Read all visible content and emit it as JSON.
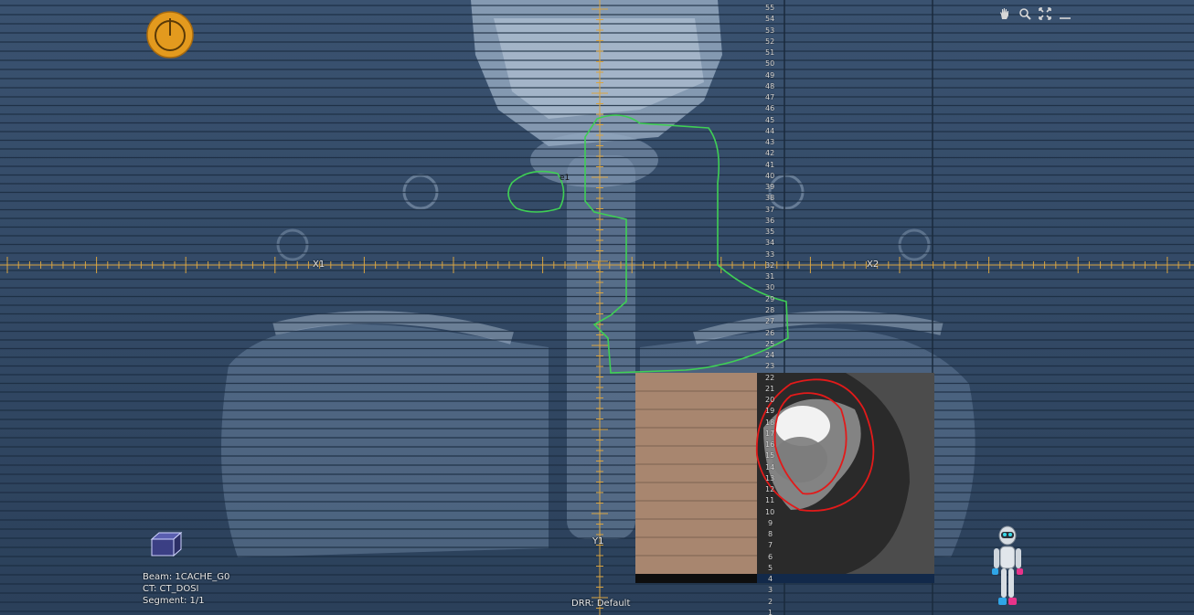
{
  "view": {
    "x_jaw_left_label": "X1",
    "x_jaw_right_label": "X2",
    "y_jaw_label": "Y1",
    "structure_label": "e1"
  },
  "info": {
    "beam": "Beam: 1CACHE_G0",
    "ct": "CT: CT_DOSI",
    "segment": "Segment: 1/1"
  },
  "drr": "DRR: Default",
  "ruler": {
    "numbers": [
      55,
      54,
      53,
      52,
      51,
      50,
      49,
      48,
      47,
      46,
      45,
      44,
      43,
      42,
      41,
      40,
      39,
      38,
      37,
      36,
      35,
      34,
      33,
      32,
      31,
      30,
      29,
      28,
      27,
      26,
      25,
      24,
      23,
      22,
      21,
      20,
      19,
      18,
      17,
      16,
      15,
      14,
      13,
      12,
      11,
      10,
      9,
      8,
      7,
      6,
      5,
      4,
      3,
      2,
      1
    ]
  },
  "toolbar": {
    "icons": [
      "hand-icon",
      "zoom-icon",
      "fit-screen-icon",
      "minimize-icon"
    ]
  },
  "colors": {
    "background": "#30455f",
    "crosshair": "#d9a441",
    "leaf_lines": "#1c2c40",
    "structure_green": "#3fcf55",
    "structure_red": "#e21a1a",
    "logo": "#e39a1e"
  }
}
